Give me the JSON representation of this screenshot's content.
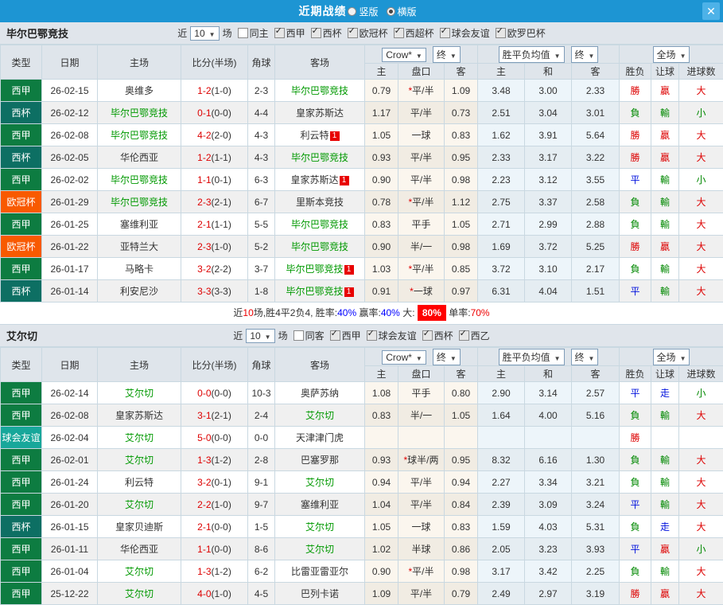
{
  "colors": {
    "titlebar_bg": "#1d95d3",
    "close_button_bg": "#4db2e8",
    "header_bg": "#dfe5eb",
    "border": "#c9d8e1",
    "stripe": "#f0f0f0",
    "handicap_col_bg": "#fbf6ee",
    "average_col_bg": "#edf5fa",
    "score_red": "#e00000",
    "focus_team_green": "#009900",
    "badge_red": "#e80000",
    "win_red": "#dd0000",
    "lose_green": "#008800",
    "draw_blue": "#0011dd",
    "highlight_bg": "#ff0000"
  },
  "titlebar": {
    "title": "近期战绩",
    "close_icon": "✕",
    "radios": [
      {
        "label": "竖版",
        "selected": false
      },
      {
        "label": "横版",
        "selected": true
      }
    ]
  },
  "table_header": {
    "cols": [
      "类型",
      "日期",
      "主场",
      "比分(半场)",
      "角球",
      "客场"
    ],
    "sub": [
      "主",
      "盘口",
      "客",
      "主",
      "和",
      "客",
      "胜负",
      "让球",
      "进球数"
    ]
  },
  "type_colors": {
    "西甲": "#0d7c41",
    "西杯": "#0d6f63",
    "欧冠杯": "#f85a00",
    "球会友谊": "#17a79a"
  },
  "result_colors": {
    "勝": "red",
    "贏": "red",
    "大": "red",
    "負": "green",
    "輸": "green",
    "小": "green",
    "平": "blue",
    "走": "blue"
  },
  "row_fields": [
    "type",
    "date",
    "home",
    "home_is_focus",
    "score",
    "half",
    "corners",
    "away",
    "away_is_focus",
    "away_badge",
    "odds_home",
    "handicap_star",
    "handicap",
    "odds_away",
    "avg_home",
    "avg_draw",
    "avg_away",
    "result",
    "handicap_result",
    "goals_result"
  ],
  "sections": [
    {
      "team": "毕尔巴鄂竞技",
      "filter": {
        "near_label": "近",
        "count": "10",
        "games_label": "场",
        "venue_label": "同主",
        "venue_checked": false,
        "leagues": [
          {
            "label": "西甲",
            "checked": true
          },
          {
            "label": "西杯",
            "checked": true
          },
          {
            "label": "欧冠杯",
            "checked": true
          },
          {
            "label": "西超杯",
            "checked": true
          },
          {
            "label": "球会友谊",
            "checked": true
          },
          {
            "label": "欧罗巴杯",
            "checked": true
          }
        ]
      },
      "selects": {
        "bookmaker": "Crow*",
        "bookmaker_final": "终",
        "average": "胜平负均值",
        "average_final": "终",
        "scope": "全场"
      },
      "rows": [
        [
          "西甲",
          "26-02-15",
          "奥维多",
          false,
          "1-2",
          "(1-0)",
          "2-3",
          "毕尔巴鄂竞技",
          true,
          "",
          "0.79",
          true,
          "平/半",
          "1.09",
          "3.48",
          "3.00",
          "2.33",
          "勝",
          "贏",
          "大"
        ],
        [
          "西杯",
          "26-02-12",
          "毕尔巴鄂竞技",
          true,
          "0-1",
          "(0-0)",
          "4-4",
          "皇家苏斯达",
          false,
          "",
          "1.17",
          false,
          "平/半",
          "0.73",
          "2.51",
          "3.04",
          "3.01",
          "負",
          "輸",
          "小"
        ],
        [
          "西甲",
          "26-02-08",
          "毕尔巴鄂竞技",
          true,
          "4-2",
          "(2-0)",
          "4-3",
          "利云特",
          false,
          "1",
          "1.05",
          false,
          "一球",
          "0.83",
          "1.62",
          "3.91",
          "5.64",
          "勝",
          "贏",
          "大"
        ],
        [
          "西杯",
          "26-02-05",
          "华伦西亚",
          false,
          "1-2",
          "(1-1)",
          "4-3",
          "毕尔巴鄂竞技",
          true,
          "",
          "0.93",
          false,
          "平/半",
          "0.95",
          "2.33",
          "3.17",
          "3.22",
          "勝",
          "贏",
          "大"
        ],
        [
          "西甲",
          "26-02-02",
          "毕尔巴鄂竞技",
          true,
          "1-1",
          "(0-1)",
          "6-3",
          "皇家苏斯达",
          false,
          "1",
          "0.90",
          false,
          "平/半",
          "0.98",
          "2.23",
          "3.12",
          "3.55",
          "平",
          "輸",
          "小"
        ],
        [
          "欧冠杯",
          "26-01-29",
          "毕尔巴鄂竞技",
          true,
          "2-3",
          "(2-1)",
          "6-7",
          "里斯本竞技",
          false,
          "",
          "0.78",
          true,
          "平/半",
          "1.12",
          "2.75",
          "3.37",
          "2.58",
          "負",
          "輸",
          "大"
        ],
        [
          "西甲",
          "26-01-25",
          "塞维利亚",
          false,
          "2-1",
          "(1-1)",
          "5-5",
          "毕尔巴鄂竞技",
          true,
          "",
          "0.83",
          false,
          "平手",
          "1.05",
          "2.71",
          "2.99",
          "2.88",
          "負",
          "輸",
          "大"
        ],
        [
          "欧冠杯",
          "26-01-22",
          "亚特兰大",
          false,
          "2-3",
          "(1-0)",
          "5-2",
          "毕尔巴鄂竞技",
          true,
          "",
          "0.90",
          false,
          "半/一",
          "0.98",
          "1.69",
          "3.72",
          "5.25",
          "勝",
          "贏",
          "大"
        ],
        [
          "西甲",
          "26-01-17",
          "马略卡",
          false,
          "3-2",
          "(2-2)",
          "3-7",
          "毕尔巴鄂竞技",
          true,
          "1",
          "1.03",
          true,
          "平/半",
          "0.85",
          "3.72",
          "3.10",
          "2.17",
          "負",
          "輸",
          "大"
        ],
        [
          "西杯",
          "26-01-14",
          "利安尼沙",
          false,
          "3-3",
          "(3-3)",
          "1-8",
          "毕尔巴鄂竞技",
          true,
          "1",
          "0.91",
          true,
          "一球",
          "0.97",
          "6.31",
          "4.04",
          "1.51",
          "平",
          "輸",
          "大"
        ]
      ],
      "summary": [
        {
          "t": "近",
          "s": "plain"
        },
        {
          "t": "10",
          "s": "red"
        },
        {
          "t": "场,胜4平2负4, 胜率:",
          "s": "plain"
        },
        {
          "t": "40%",
          "s": "blue"
        },
        {
          "t": " 赢率:",
          "s": "plain"
        },
        {
          "t": "40%",
          "s": "blue"
        },
        {
          "t": " 大: ",
          "s": "plain"
        },
        {
          "t": "80%",
          "s": "highlight"
        },
        {
          "t": " 单率:",
          "s": "plain"
        },
        {
          "t": "70%",
          "s": "red"
        }
      ]
    },
    {
      "team": "艾尔切",
      "filter": {
        "near_label": "近",
        "count": "10",
        "games_label": "场",
        "venue_label": "同客",
        "venue_checked": false,
        "leagues": [
          {
            "label": "西甲",
            "checked": true
          },
          {
            "label": "球会友谊",
            "checked": true
          },
          {
            "label": "西杯",
            "checked": true
          },
          {
            "label": "西乙",
            "checked": true
          }
        ]
      },
      "selects": {
        "bookmaker": "Crow*",
        "bookmaker_final": "终",
        "average": "胜平负均值",
        "average_final": "终",
        "scope": "全场"
      },
      "rows": [
        [
          "西甲",
          "26-02-14",
          "艾尔切",
          true,
          "0-0",
          "(0-0)",
          "10-3",
          "奥萨苏纳",
          false,
          "",
          "1.08",
          false,
          "平手",
          "0.80",
          "2.90",
          "3.14",
          "2.57",
          "平",
          "走",
          "小"
        ],
        [
          "西甲",
          "26-02-08",
          "皇家苏斯达",
          false,
          "3-1",
          "(2-1)",
          "2-4",
          "艾尔切",
          true,
          "",
          "0.83",
          false,
          "半/一",
          "1.05",
          "1.64",
          "4.00",
          "5.16",
          "負",
          "輸",
          "大"
        ],
        [
          "球会友谊",
          "26-02-04",
          "艾尔切",
          true,
          "5-0",
          "(0-0)",
          "0-0",
          "天津津门虎",
          false,
          "",
          "",
          false,
          "",
          "",
          "",
          "",
          "",
          "勝",
          "",
          ""
        ],
        [
          "西甲",
          "26-02-01",
          "艾尔切",
          true,
          "1-3",
          "(1-2)",
          "2-8",
          "巴塞罗那",
          false,
          "",
          "0.93",
          true,
          "球半/两",
          "0.95",
          "8.32",
          "6.16",
          "1.30",
          "負",
          "輸",
          "大"
        ],
        [
          "西甲",
          "26-01-24",
          "利云特",
          false,
          "3-2",
          "(0-1)",
          "9-1",
          "艾尔切",
          true,
          "",
          "0.94",
          false,
          "平/半",
          "0.94",
          "2.27",
          "3.34",
          "3.21",
          "負",
          "輸",
          "大"
        ],
        [
          "西甲",
          "26-01-20",
          "艾尔切",
          true,
          "2-2",
          "(1-0)",
          "9-7",
          "塞维利亚",
          false,
          "",
          "1.04",
          false,
          "平/半",
          "0.84",
          "2.39",
          "3.09",
          "3.24",
          "平",
          "輸",
          "大"
        ],
        [
          "西杯",
          "26-01-15",
          "皇家贝迪斯",
          false,
          "2-1",
          "(0-0)",
          "1-5",
          "艾尔切",
          true,
          "",
          "1.05",
          false,
          "一球",
          "0.83",
          "1.59",
          "4.03",
          "5.31",
          "負",
          "走",
          "大"
        ],
        [
          "西甲",
          "26-01-11",
          "华伦西亚",
          false,
          "1-1",
          "(0-0)",
          "8-6",
          "艾尔切",
          true,
          "",
          "1.02",
          false,
          "半球",
          "0.86",
          "2.05",
          "3.23",
          "3.93",
          "平",
          "贏",
          "小"
        ],
        [
          "西甲",
          "26-01-04",
          "艾尔切",
          true,
          "1-3",
          "(1-2)",
          "6-2",
          "比雷亚雷亚尔",
          false,
          "",
          "0.90",
          true,
          "平/半",
          "0.98",
          "3.17",
          "3.42",
          "2.25",
          "負",
          "輸",
          "大"
        ],
        [
          "西甲",
          "25-12-22",
          "艾尔切",
          true,
          "4-0",
          "(1-0)",
          "4-5",
          "巴列卡诺",
          false,
          "",
          "1.09",
          false,
          "平/半",
          "0.79",
          "2.49",
          "2.97",
          "3.19",
          "勝",
          "贏",
          "大"
        ]
      ],
      "summary": null
    }
  ]
}
